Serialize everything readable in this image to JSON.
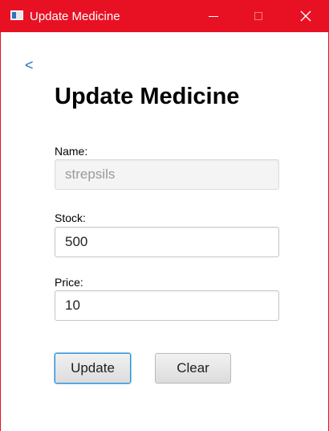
{
  "window": {
    "title": "Update Medicine",
    "accent_color": "#e81123",
    "icons": {
      "app": "app-window-icon",
      "minimize": "minimize-icon",
      "maximize": "maximize-icon",
      "close": "close-icon"
    }
  },
  "nav": {
    "back_label": "<"
  },
  "form": {
    "heading": "Update Medicine",
    "name": {
      "label": "Name:",
      "value": "strepsils",
      "disabled": true
    },
    "stock": {
      "label": "Stock:",
      "value": "500"
    },
    "price": {
      "label": "Price:",
      "value": "10"
    }
  },
  "actions": {
    "update_label": "Update",
    "clear_label": "Clear",
    "focus_color": "#2d90d4"
  }
}
